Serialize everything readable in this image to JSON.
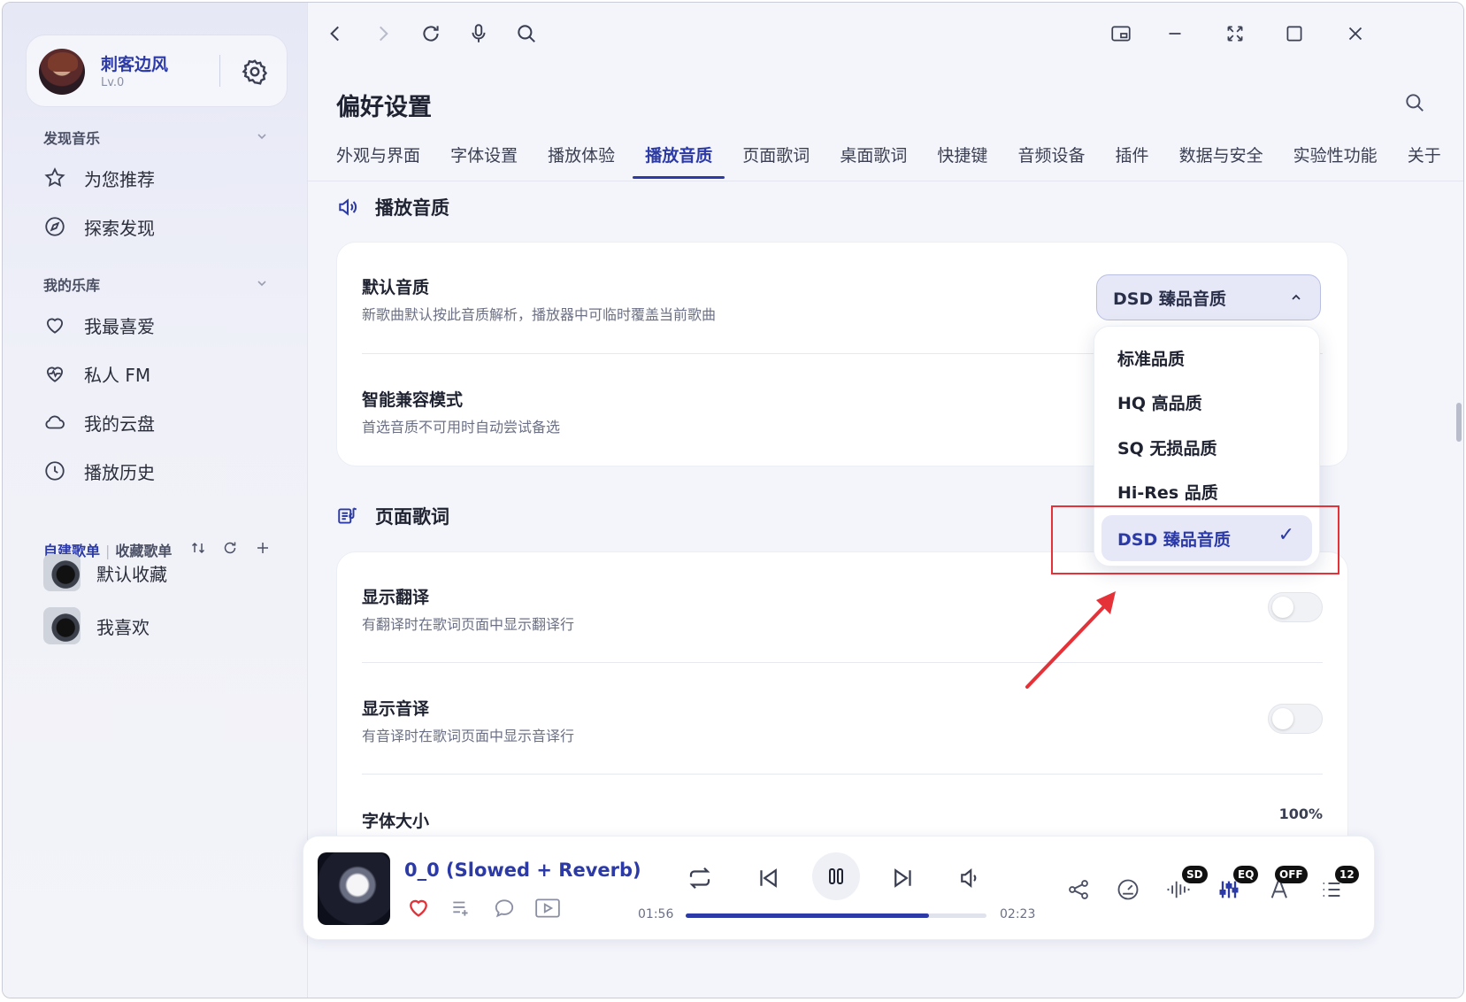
{
  "user": {
    "name": "刺客边风",
    "level": "Lv.0"
  },
  "sidebar": {
    "discover_title": "发现音乐",
    "discover_items": [
      {
        "label": "为您推荐",
        "icon": "star-icon"
      },
      {
        "label": "探索发现",
        "icon": "compass-icon"
      }
    ],
    "library_title": "我的乐库",
    "library_items": [
      {
        "label": "我最喜爱",
        "icon": "heart-icon"
      },
      {
        "label": "私人 FM",
        "icon": "heartbeat-icon"
      },
      {
        "label": "我的云盘",
        "icon": "cloud-icon"
      },
      {
        "label": "播放历史",
        "icon": "clock-icon"
      }
    ],
    "playlist_tab_created": "自建歌单",
    "playlist_tab_separator": "|",
    "playlist_tab_collected": "收藏歌单",
    "playlists": [
      {
        "label": "默认收藏"
      },
      {
        "label": "我喜欢"
      }
    ]
  },
  "main": {
    "page_title": "偏好设置",
    "tabs": [
      {
        "label": "外观与界面"
      },
      {
        "label": "字体设置"
      },
      {
        "label": "播放体验"
      },
      {
        "label": "播放音质"
      },
      {
        "label": "页面歌词"
      },
      {
        "label": "桌面歌词"
      },
      {
        "label": "快捷键"
      },
      {
        "label": "音频设备"
      },
      {
        "label": "插件"
      },
      {
        "label": "数据与安全"
      },
      {
        "label": "实验性功能"
      },
      {
        "label": "关于"
      }
    ],
    "active_tab": "播放音质",
    "quality_section": {
      "title": "播放音质",
      "default_quality": {
        "title": "默认音质",
        "desc": "新歌曲默认按此音质解析，播放器中可临时覆盖当前歌曲",
        "selected": "DSD 臻品音质",
        "options": [
          {
            "label": "标准品质"
          },
          {
            "label": "HQ 高品质"
          },
          {
            "label": "SQ 无损品质"
          },
          {
            "label": "Hi-Res 品质"
          },
          {
            "label": "DSD 臻品音质",
            "selected": true
          }
        ],
        "check_mark": "✓"
      },
      "smart_compat": {
        "title": "智能兼容模式",
        "desc": "首选音质不可用时自动尝试备选"
      }
    },
    "lyrics_section": {
      "title": "页面歌词",
      "show_translation": {
        "title": "显示翻译",
        "desc": "有翻译时在歌词页面中显示翻译行",
        "enabled": false
      },
      "show_romaji": {
        "title": "显示音译",
        "desc": "有音译时在歌词页面中显示音译行",
        "enabled": false
      },
      "font_size": {
        "title": "字体大小",
        "value": "100%"
      }
    }
  },
  "player": {
    "song_title": "0_0 (Slowed + Reverb)",
    "elapsed": "01:56",
    "duration": "02:23",
    "progress": 0.81,
    "badges": {
      "quality": "SD",
      "eq": "EQ",
      "lyric": "OFF",
      "queue": "12"
    }
  },
  "colors": {
    "accent": "#2b3aa6",
    "annotation_red": "#e53238",
    "favorite_red": "#e0343a"
  }
}
